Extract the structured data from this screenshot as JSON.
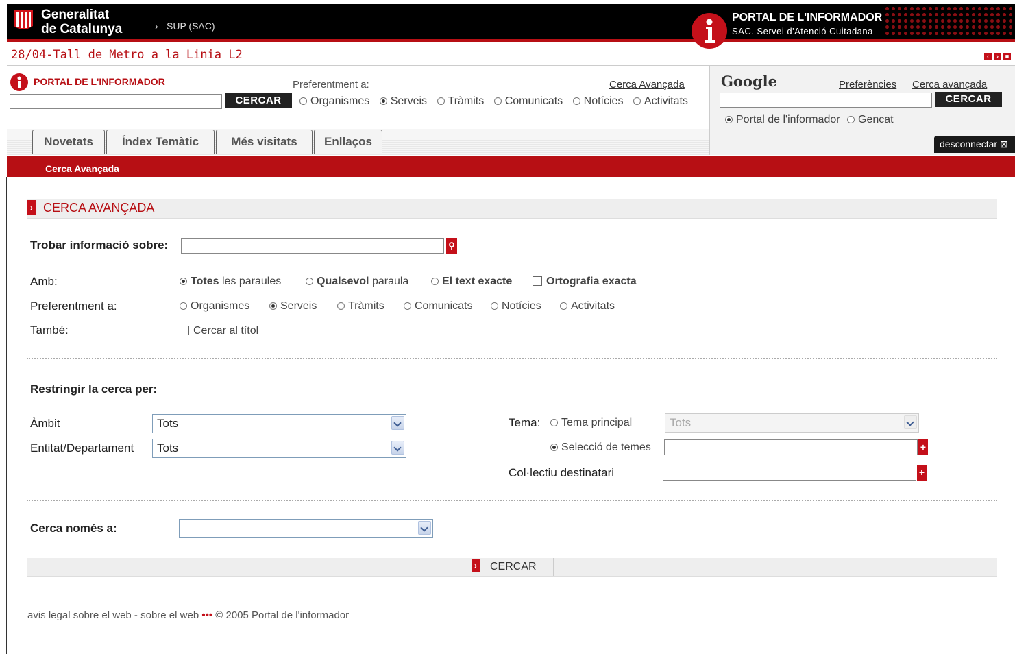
{
  "header": {
    "logo_line1": "Generalitat",
    "logo_line2": "de Catalunya",
    "crumb": "SUP (SAC)",
    "portal_title": "PORTAL DE L'INFORMADOR",
    "portal_sub": "SAC. Servei d'Atenció Cuitadana"
  },
  "ticker": "28/04-Tall de Metro a la Linia L2",
  "search": {
    "brand": "PORTAL DE L'INFORMADOR",
    "button": "CERCAR",
    "pref_label": "Preferentment a:",
    "advanced_link": "Cerca Avançada",
    "options": [
      "Organismes",
      "Serveis",
      "Tràmits",
      "Comunicats",
      "Notícies",
      "Activitats"
    ],
    "selected": "Serveis"
  },
  "google": {
    "brand": "Google",
    "prefs": "Preferències",
    "advanced": "Cerca avançada",
    "button": "CERCAR",
    "opt1": "Portal de l'informador",
    "opt2": "Gencat"
  },
  "tabs": [
    "Novetats",
    "Índex Temàtic",
    "Més visitats",
    "Enllaços"
  ],
  "disconnect": "desconnectar",
  "breadcrumb": "Cerca Avançada",
  "section_title": "CERCA AVANÇADA",
  "form": {
    "find_label": "Trobar informació sobre:",
    "amb_label": "Amb:",
    "amb_opt1_a": "Totes",
    "amb_opt1_b": "les paraules",
    "amb_opt2_a": "Qualsevol",
    "amb_opt2_b": "paraula",
    "amb_opt3": "El text exacte",
    "amb_chk": "Ortografia exacta",
    "pref_label": "Preferentment a:",
    "pref_options": [
      "Organismes",
      "Serveis",
      "Tràmits",
      "Comunicats",
      "Notícies",
      "Activitats"
    ],
    "tambe_label": "També:",
    "tambe_chk": "Cercar al títol",
    "restrict_label": "Restringir la cerca per:",
    "ambit_label": "Àmbit",
    "ambit_value": "Tots",
    "entitat_label": "Entitat/Departament",
    "entitat_value": "Tots",
    "tema_label": "Tema:",
    "tema_opt1": "Tema principal",
    "tema_select": "Tots",
    "tema_opt2": "Selecció de temes",
    "collectiu_label": "Col·lectiu destinatari",
    "only_label": "Cerca només a:",
    "submit": "CERCAR"
  },
  "footer": {
    "link1": "avis legal sobre el web",
    "sep": " - ",
    "link2": "sobre el web",
    "bullets": "•••",
    "copy": "© 2005 Portal de l'informador"
  }
}
